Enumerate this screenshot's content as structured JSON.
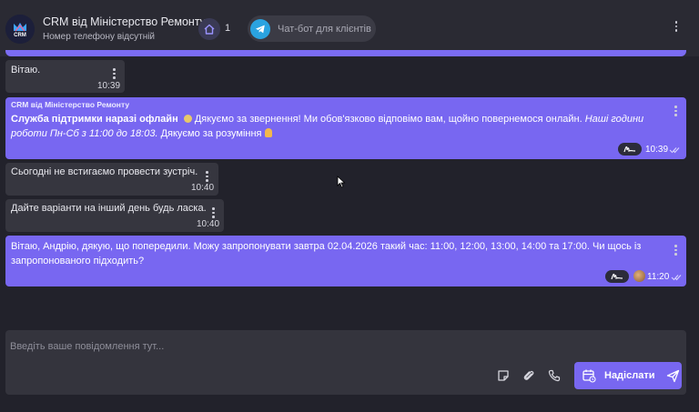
{
  "header": {
    "title": "CRM від Міністерство Ремонту",
    "subtitle": "Номер телефону відсутній",
    "avatar_text": "CRM",
    "home_count": "1",
    "telegram_label": "Чат-бот для клієнтів"
  },
  "messages": [
    {
      "direction": "incoming",
      "text": "Вітаю.",
      "time": "10:39"
    },
    {
      "direction": "outgoing",
      "sender": "CRM від Міністерство Ремонту",
      "bold_text": "Служба підтримки наразі офлайн",
      "text_1": " Дякуємо за звернення! Ми обов'язково відповімо вам, щойно повернемося онлайн. ",
      "italic_text": "Наші години роботи Пн-Сб з 11:00 до 18:03.",
      "text_2": " Дякуємо за розуміння ",
      "time": "10:39"
    },
    {
      "direction": "incoming",
      "text": "Сьогодні не встигаємо провести зустріч.",
      "time": "10:40"
    },
    {
      "direction": "incoming",
      "text": "Дайте варіанти на інший день будь ласка.",
      "time": "10:40"
    },
    {
      "direction": "outgoing",
      "text": "Вітаю, Андрію, дякую, що попередили. Можу запропонувати завтра 02.04.2026 такий час: 11:00, 12:00, 13:00, 14:00 та 17:00. Чи щось із запропонованого підходить?",
      "time": "11:20"
    }
  ],
  "composer": {
    "placeholder": "Введіть ваше повідомлення тут...",
    "send_label": "Надіслати"
  },
  "colors": {
    "accent": "#7867f1",
    "incoming_bubble": "#36363f",
    "background": "#22222b",
    "telegram": "#2aa3e0"
  }
}
